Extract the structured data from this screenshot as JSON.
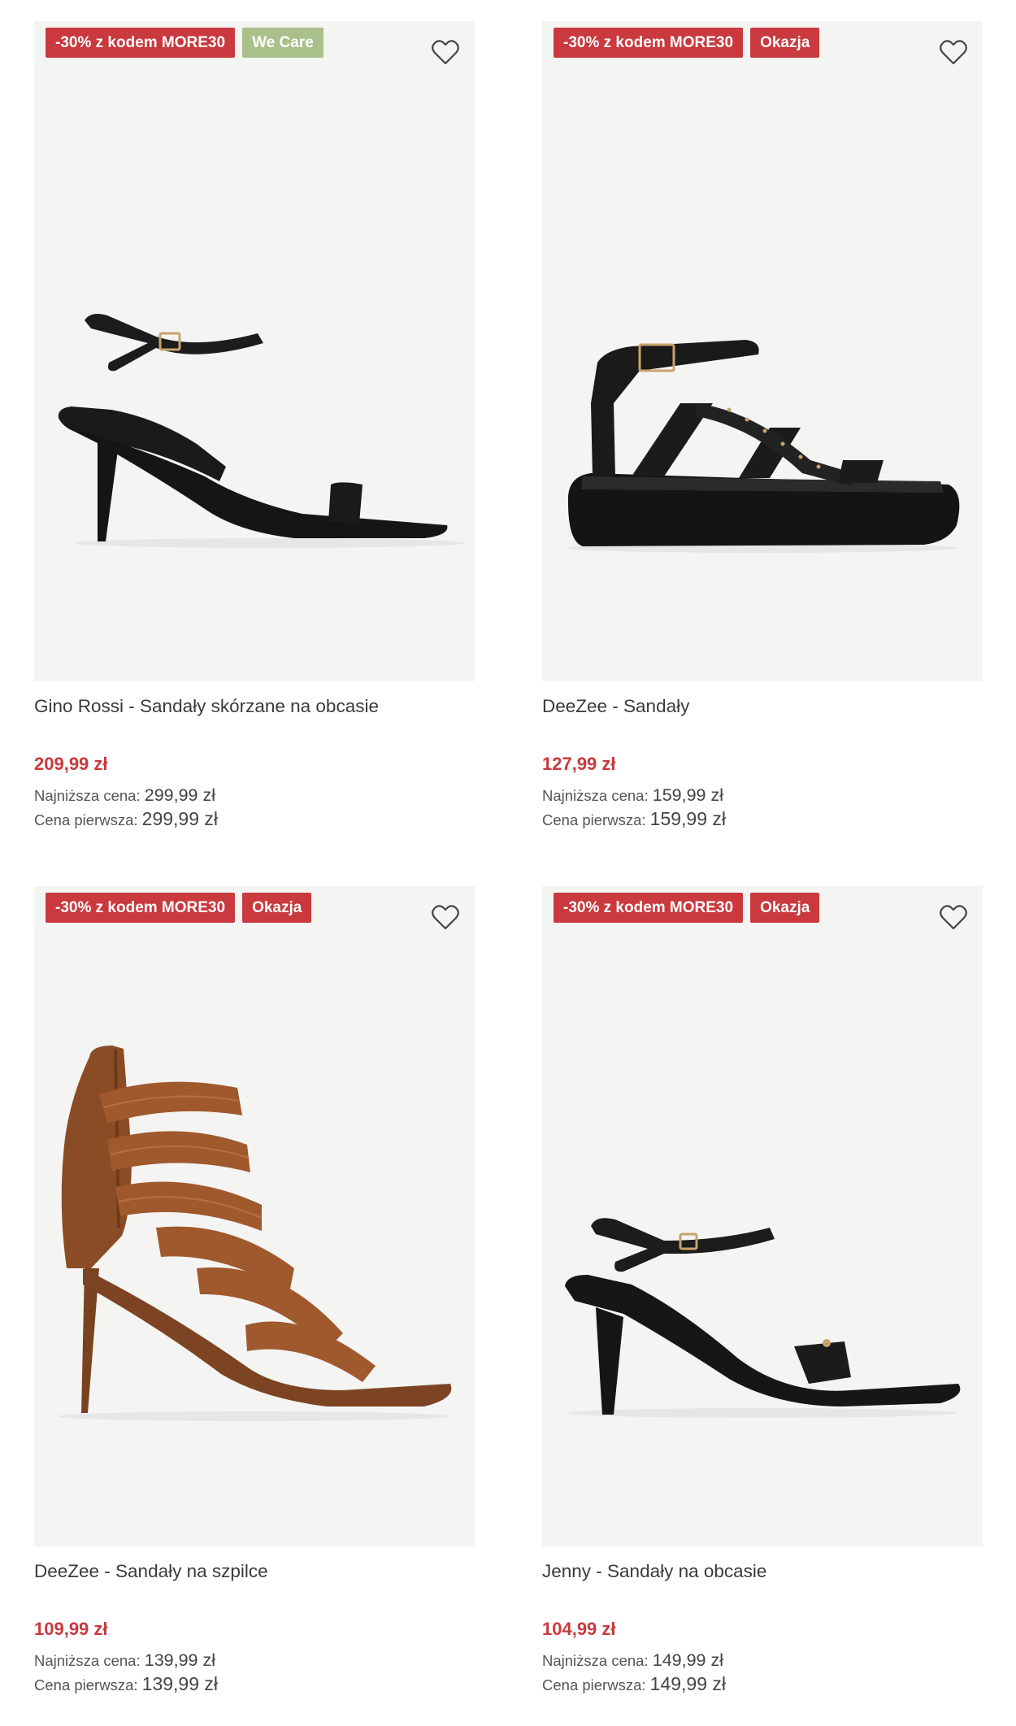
{
  "colors": {
    "accent_red": "#c9393d",
    "we_care_green": "#a9c08a",
    "image_bg": "#f4f4f3"
  },
  "products": [
    {
      "badges": [
        "-30% z kodem MORE30",
        "We Care"
      ],
      "title": "Gino Rossi - Sandały skórzane na obcasie",
      "price": "209,99 zł",
      "lowest_label": "Najniższa cena:",
      "lowest_value": "299,99 zł",
      "first_label": "Cena pierwsza:",
      "first_value": "299,99 zł",
      "image": "black-heeled-sandal"
    },
    {
      "badges": [
        "-30% z kodem MORE30",
        "Okazja"
      ],
      "title": "DeeZee - Sandały",
      "price": "127,99 zł",
      "lowest_label": "Najniższa cena:",
      "lowest_value": "159,99 zł",
      "first_label": "Cena pierwsza:",
      "first_value": "159,99 zł",
      "image": "black-platform-gladiator-sandal"
    },
    {
      "badges": [
        "-30% z kodem MORE30",
        "Okazja"
      ],
      "title": "DeeZee - Sandały na szpilce",
      "price": "109,99 zł",
      "lowest_label": "Najniższa cena:",
      "lowest_value": "139,99 zł",
      "first_label": "Cena pierwsza:",
      "first_value": "139,99 zł",
      "image": "brown-strappy-stiletto-sandal"
    },
    {
      "badges": [
        "-30% z kodem MORE30",
        "Okazja"
      ],
      "title": "Jenny - Sandały na obcasie",
      "price": "104,99 zł",
      "lowest_label": "Najniższa cena:",
      "lowest_value": "149,99 zł",
      "first_label": "Cena pierwsza:",
      "first_value": "149,99 zł",
      "image": "black-kitten-heel-sandal"
    }
  ],
  "icons": {
    "favorite": "heart-outline-icon"
  }
}
